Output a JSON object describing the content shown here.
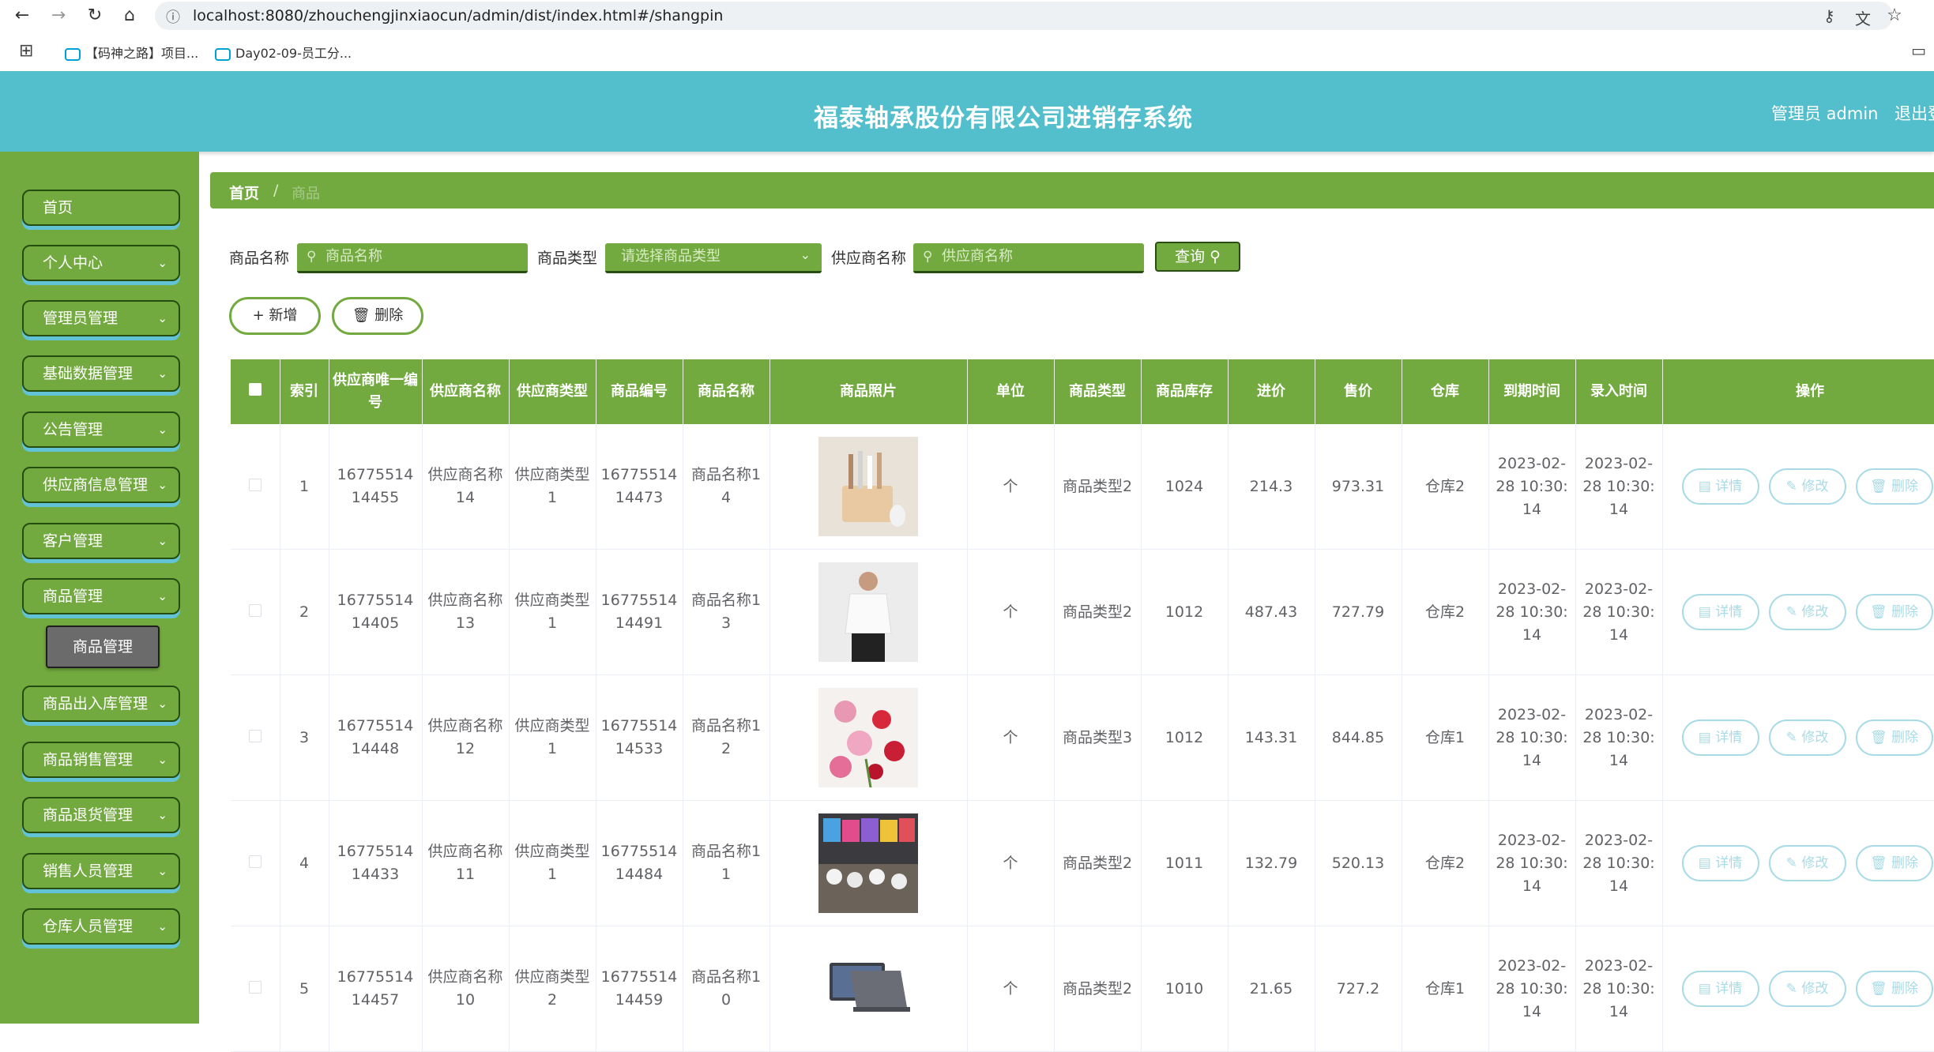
{
  "browser": {
    "url": "localhost:8080/zhouchengjinxiaocun/admin/dist/index.html#/shangpin",
    "bookmarks": [
      "【码神之路】项目...",
      "Day02-09-员工分..."
    ]
  },
  "header": {
    "title": "福泰轴承股份有限公司进销存系统",
    "admin_label": "管理员 admin",
    "logout_label": "退出登录"
  },
  "sidebar": {
    "items": [
      {
        "label": "首页",
        "has_arrow": false
      },
      {
        "label": "个人中心",
        "has_arrow": true
      },
      {
        "label": "管理员管理",
        "has_arrow": true
      },
      {
        "label": "基础数据管理",
        "has_arrow": true
      },
      {
        "label": "公告管理",
        "has_arrow": true
      },
      {
        "label": "供应商信息管理",
        "has_arrow": true
      },
      {
        "label": "客户管理",
        "has_arrow": true
      },
      {
        "label": "商品管理",
        "has_arrow": true
      },
      {
        "label": "商品出入库管理",
        "has_arrow": true
      },
      {
        "label": "商品销售管理",
        "has_arrow": true
      },
      {
        "label": "商品退货管理",
        "has_arrow": true
      },
      {
        "label": "销售人员管理",
        "has_arrow": true
      },
      {
        "label": "仓库人员管理",
        "has_arrow": true
      }
    ],
    "submenu_label": "商品管理"
  },
  "breadcrumb": {
    "home": "首页",
    "separator": "/",
    "current": "商品"
  },
  "search": {
    "name_label": "商品名称",
    "name_placeholder": "商品名称",
    "type_label": "商品类型",
    "type_placeholder": "请选择商品类型",
    "supplier_label": "供应商名称",
    "supplier_placeholder": "供应商名称",
    "query_label": "查询"
  },
  "actions": {
    "add_label": "+ 新增",
    "delete_label": "删除"
  },
  "table": {
    "headers": [
      "索引",
      "供应商唯一编号",
      "供应商名称",
      "供应商类型",
      "商品编号",
      "商品名称",
      "商品照片",
      "单位",
      "商品类型",
      "商品库存",
      "进价",
      "售价",
      "仓库",
      "到期时间",
      "录入时间",
      "操作"
    ],
    "op_labels": {
      "detail": "详情",
      "edit": "修改",
      "delete": "删除"
    },
    "rows": [
      {
        "index": "1",
        "supplier_id": "1677551414455",
        "supplier_name": "供应商名称14",
        "supplier_type": "供应商类型1",
        "goods_id": "1677551414473",
        "goods_name": "商品名称14",
        "photo": "kitchen-utensils-photo",
        "unit": "个",
        "goods_type": "商品类型2",
        "stock": "1024",
        "cost": "214.3",
        "price": "973.31",
        "warehouse": "仓库2",
        "expire": "2023-02-28 10:30:14",
        "created": "2023-02-28 10:30:14"
      },
      {
        "index": "2",
        "supplier_id": "1677551414405",
        "supplier_name": "供应商名称13",
        "supplier_type": "供应商类型1",
        "goods_id": "1677551414491",
        "goods_name": "商品名称13",
        "photo": "white-shirt-man-photo",
        "unit": "个",
        "goods_type": "商品类型2",
        "stock": "1012",
        "cost": "487.43",
        "price": "727.79",
        "warehouse": "仓库2",
        "expire": "2023-02-28 10:30:14",
        "created": "2023-02-28 10:30:14"
      },
      {
        "index": "3",
        "supplier_id": "1677551414448",
        "supplier_name": "供应商名称12",
        "supplier_type": "供应商类型1",
        "goods_id": "1677551414533",
        "goods_name": "商品名称12",
        "photo": "flowers-photo",
        "unit": "个",
        "goods_type": "商品类型3",
        "stock": "1012",
        "cost": "143.31",
        "price": "844.85",
        "warehouse": "仓库1",
        "expire": "2023-02-28 10:30:14",
        "created": "2023-02-28 10:30:14"
      },
      {
        "index": "4",
        "supplier_id": "1677551414433",
        "supplier_name": "供应商名称11",
        "supplier_type": "供应商类型1",
        "goods_id": "1677551414484",
        "goods_name": "商品名称11",
        "photo": "market-stall-photo",
        "unit": "个",
        "goods_type": "商品类型2",
        "stock": "1011",
        "cost": "132.79",
        "price": "520.13",
        "warehouse": "仓库2",
        "expire": "2023-02-28 10:30:14",
        "created": "2023-02-28 10:30:14"
      },
      {
        "index": "5",
        "supplier_id": "1677551414457",
        "supplier_name": "供应商名称10",
        "supplier_type": "供应商类型2",
        "goods_id": "1677551414459",
        "goods_name": "商品名称10",
        "photo": "laptop-photo",
        "unit": "个",
        "goods_type": "商品类型2",
        "stock": "1010",
        "cost": "21.65",
        "price": "727.2",
        "warehouse": "仓库1",
        "expire": "2023-02-28 10:30:14",
        "created": "2023-02-28 10:30:14"
      }
    ]
  },
  "colors": {
    "header": "#54bfcc",
    "sidebar": "#73aa40",
    "accent_shadow": "#61c3d5",
    "op_button": "#a8dbe6"
  }
}
